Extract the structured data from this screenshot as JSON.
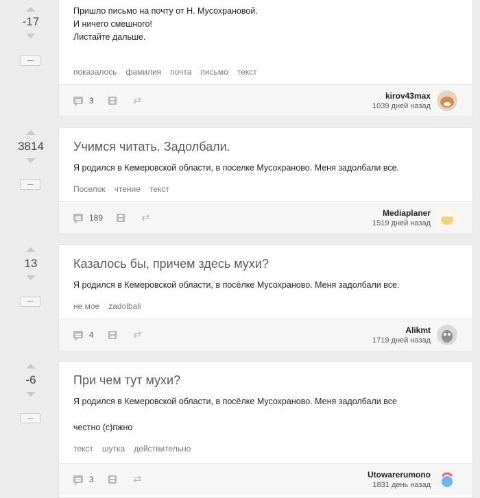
{
  "posts": [
    {
      "score": "-17",
      "title": "",
      "lines": [
        "Пришло письмо на почту от Н. Мусохрановой.",
        "И ничего смешного!",
        "Листайте дальше."
      ],
      "tags": [
        "показалось",
        "фамилия",
        "почта",
        "письмо",
        "текст"
      ],
      "comments": "3",
      "author": "kirov43max",
      "time": "1039 дней назад",
      "avatar_color": "#d88b4e"
    },
    {
      "score": "3814",
      "title": "Учимся читать. Задолбали.",
      "lines": [
        "Я родился в Кемеровской области, в поселке Мусохраново. Меня задолбали все."
      ],
      "tags": [
        "Поселок",
        "чтение",
        "текст"
      ],
      "comments": "189",
      "author": "Mediaplaner",
      "time": "1519 дней назад",
      "avatar_color": "#f3d27a"
    },
    {
      "score": "13",
      "title": "Казалось бы, причем здесь мухи?",
      "lines": [
        "Я родился в Кемеровской области, в посёлке Мусохраново. Меня задолбали все."
      ],
      "tags": [
        "не мое",
        "zadolbali"
      ],
      "comments": "4",
      "author": "Alikmt",
      "time": "1719 дней назад",
      "avatar_color": "#8f8f8f"
    },
    {
      "score": "-6",
      "title": "При чем тут мухи?",
      "lines": [
        "Я родился в Кемеровской области, в посёлке Мусохраново. Меня задолбали все",
        "",
        "честно (с)пжно"
      ],
      "tags": [
        "текст",
        "шутка",
        "действительно"
      ],
      "comments": "3",
      "author": "Utowarerumono",
      "time": "1831 день назад",
      "avatar_color": "#6fb6e8"
    }
  ],
  "icons": {
    "comment": "comment-icon",
    "save": "save-icon",
    "share": "share-icon",
    "vote_up": "arrow-up-icon",
    "vote_down": "arrow-down-icon",
    "hide": "hide-icon"
  },
  "share_glyph": "⇄"
}
